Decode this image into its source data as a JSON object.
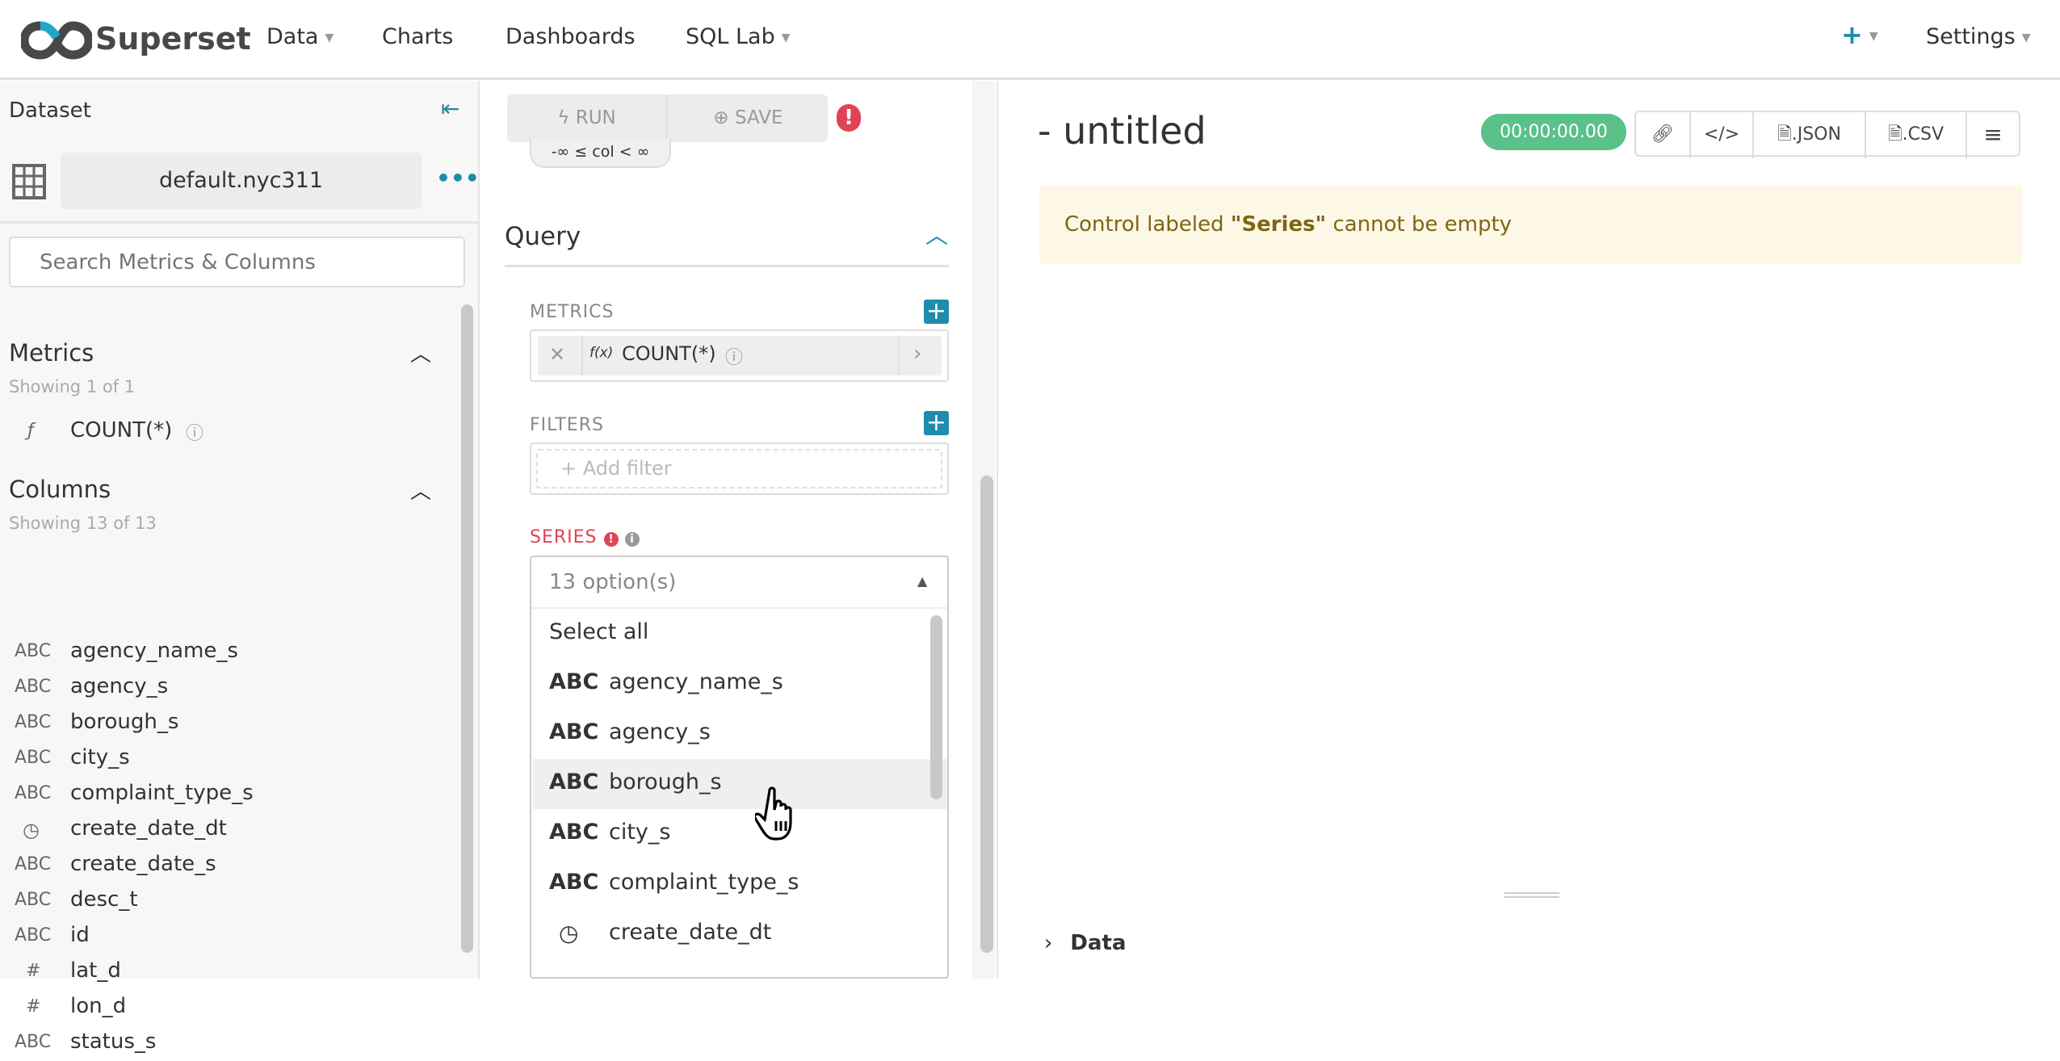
{
  "header": {
    "brand": "Superset",
    "nav": [
      {
        "label": "Data",
        "dropdown": true
      },
      {
        "label": "Charts"
      },
      {
        "label": "Dashboards"
      },
      {
        "label": "SQL Lab",
        "dropdown": true
      }
    ],
    "plus_icon": "plus-icon",
    "settings": "Settings"
  },
  "dataset_panel": {
    "title": "Dataset",
    "dataset_name": "default.nyc311",
    "search_placeholder": "Search Metrics & Columns",
    "metrics": {
      "title": "Metrics",
      "showing": "Showing 1 of 1",
      "items": [
        {
          "type": "ƒ",
          "name": "COUNT(*)"
        }
      ]
    },
    "columns": {
      "title": "Columns",
      "showing": "Showing 13 of 13",
      "items": [
        {
          "type": "ABC",
          "name": "agency_name_s"
        },
        {
          "type": "ABC",
          "name": "agency_s"
        },
        {
          "type": "ABC",
          "name": "borough_s"
        },
        {
          "type": "ABC",
          "name": "city_s"
        },
        {
          "type": "ABC",
          "name": "complaint_type_s"
        },
        {
          "type": "clock",
          "name": "create_date_dt"
        },
        {
          "type": "ABC",
          "name": "create_date_s"
        },
        {
          "type": "ABC",
          "name": "desc_t"
        },
        {
          "type": "ABC",
          "name": "id"
        },
        {
          "type": "#",
          "name": "lat_d"
        },
        {
          "type": "#",
          "name": "lon_d"
        },
        {
          "type": "ABC",
          "name": "status_s"
        }
      ]
    }
  },
  "controls": {
    "run": "RUN",
    "save": "SAVE",
    "range_pill": "-∞ ≤ col < ∞",
    "section": "Query",
    "metrics_label": "METRICS",
    "metric_value": "COUNT(*)",
    "metric_fx": "f(x)",
    "filters_label": "FILTERS",
    "add_filter": "Add filter",
    "series_label": "SERIES",
    "series_placeholder": "13 option(s)",
    "series_options": [
      {
        "type": "",
        "name": "Select all"
      },
      {
        "type": "ABC",
        "name": "agency_name_s"
      },
      {
        "type": "ABC",
        "name": "agency_s"
      },
      {
        "type": "ABC",
        "name": "borough_s",
        "highlighted": true
      },
      {
        "type": "ABC",
        "name": "city_s"
      },
      {
        "type": "ABC",
        "name": "complaint_type_s"
      },
      {
        "type": "clock",
        "name": "create_date_dt"
      }
    ]
  },
  "chart": {
    "title": "- untitled",
    "timer": "00:00:00.00",
    "buttons": {
      "json": ".JSON",
      "csv": ".CSV"
    },
    "alert_prefix": "Control labeled ",
    "alert_bold": "\"Series\"",
    "alert_suffix": " cannot be empty",
    "data_section": "Data"
  },
  "colors": {
    "accent": "#1f8bad",
    "success": "#5ac189",
    "error": "#e04355",
    "alert_bg": "#fdf8e6",
    "alert_text": "#7f6514"
  }
}
